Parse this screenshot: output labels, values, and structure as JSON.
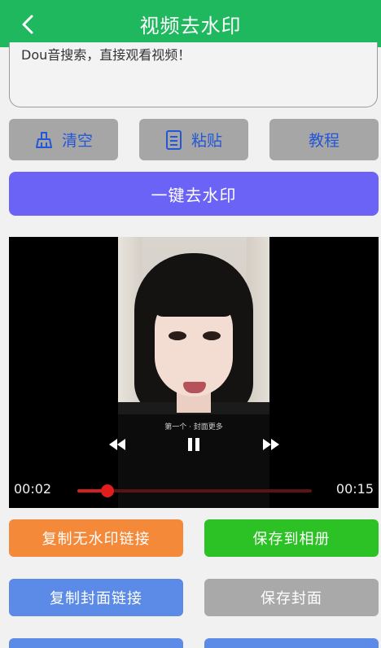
{
  "header": {
    "title": "视频去水印",
    "back_icon": "chevron-left-icon"
  },
  "input": {
    "value": "Dou音搜索，直接观看视频！"
  },
  "toolbar": {
    "clear_label": "清空",
    "paste_label": "粘贴",
    "tutorial_label": "教程",
    "clear_icon": "broom-icon",
    "paste_icon": "clipboard-icon"
  },
  "primary_action": {
    "label": "一键去水印"
  },
  "player": {
    "subtitle": "第一个 · 封面更多",
    "current_time": "00:02",
    "duration": "00:15",
    "progress": 0.13,
    "colors": {
      "progress": "#d32020"
    }
  },
  "actions": {
    "copy_link": "复制无水印链接",
    "save_album": "保存到相册",
    "copy_cover": "复制封面链接",
    "save_cover": "保存封面"
  },
  "colors": {
    "header": "#20b85f",
    "primary": "#6b63f5",
    "accent_blue": "#2357d6",
    "orange": "#f5893a",
    "green": "#2cc124",
    "blue": "#5b8be6",
    "gray": "#a9a9a9"
  }
}
